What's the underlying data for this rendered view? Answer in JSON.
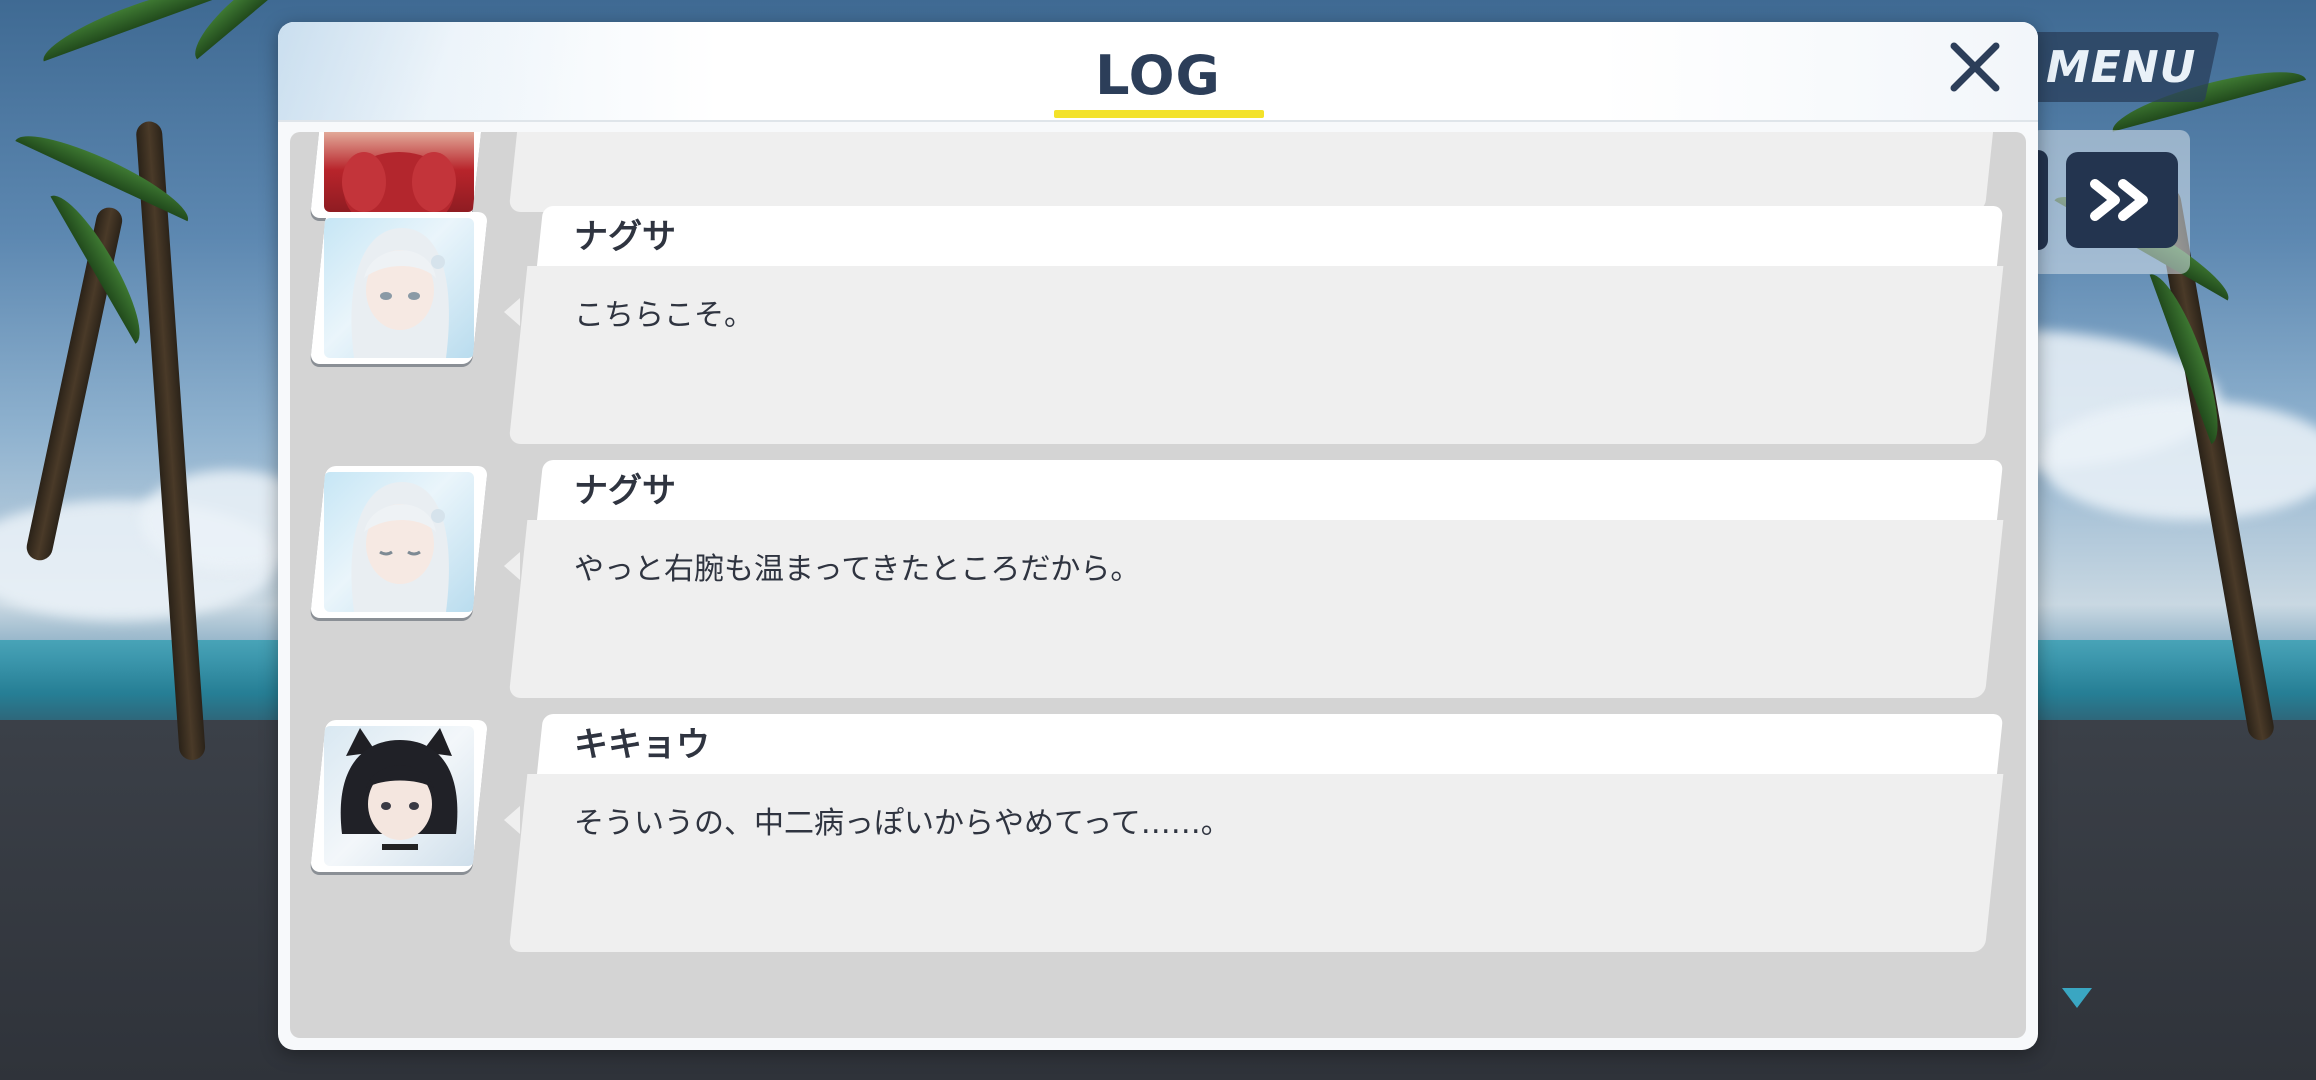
{
  "hud": {
    "menu_label": "MENU",
    "skip_icon": "double-chevron-right-icon",
    "scroll_icon": "triangle-down-icon"
  },
  "log": {
    "title": "LOG",
    "close_icon": "close-icon",
    "entries": [
      {
        "speaker": "",
        "message": "",
        "portrait": "red-haired-character-portrait"
      },
      {
        "speaker": "ナグサ",
        "message": "こちらこそ。",
        "portrait": "nagusa-portrait"
      },
      {
        "speaker": "ナグサ",
        "message": "やっと右腕も温まってきたところだから。",
        "portrait": "nagusa-portrait"
      },
      {
        "speaker": "キキョウ",
        "message": "そういうの、中二病っぽいからやめてって……。",
        "portrait": "kikyou-portrait"
      }
    ]
  },
  "colors": {
    "title_text": "#2c3e59",
    "title_underline": "#f3e22a",
    "hud_button": "#23344f",
    "log_background": "#d4d4d4",
    "message_box": "#efefef"
  }
}
